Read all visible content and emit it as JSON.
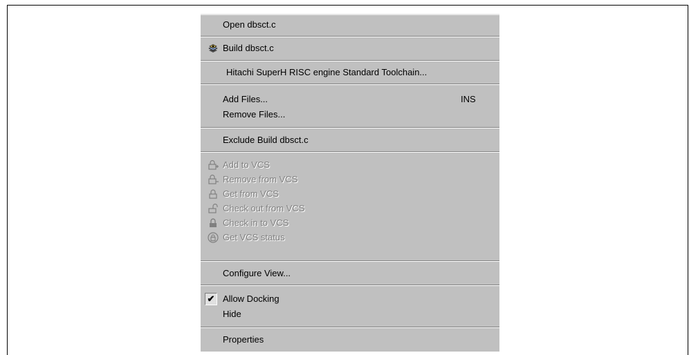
{
  "menu": {
    "open": "Open dbsct.c",
    "build": "Build dbsct.c",
    "toolchain": "Hitachi SuperH RISC engine Standard Toolchain...",
    "add_files": "Add Files...",
    "add_files_shortcut": "INS",
    "remove_files": "Remove Files...",
    "exclude_build": "Exclude Build dbsct.c",
    "vcs": {
      "add": "Add to VCS",
      "remove": "Remove from VCS",
      "get": "Get from VCS",
      "check_out": "Check out from VCS",
      "check_in": "Check in to VCS",
      "status": "Get VCS status"
    },
    "configure_view": "Configure View...",
    "allow_docking": "Allow Docking",
    "allow_docking_checked": true,
    "check_glyph": "✔",
    "hide": "Hide",
    "properties": "Properties"
  },
  "icons": {
    "build": "build-icon",
    "vcs_add": "vcs-add-icon",
    "vcs_remove": "vcs-remove-icon",
    "vcs_get": "vcs-get-icon",
    "vcs_check_out": "vcs-check-out-icon",
    "vcs_check_in": "vcs-check-in-icon",
    "vcs_status": "vcs-status-icon"
  },
  "colors": {
    "menu_bg": "#c0c0c0",
    "disabled_text": "#808080"
  }
}
